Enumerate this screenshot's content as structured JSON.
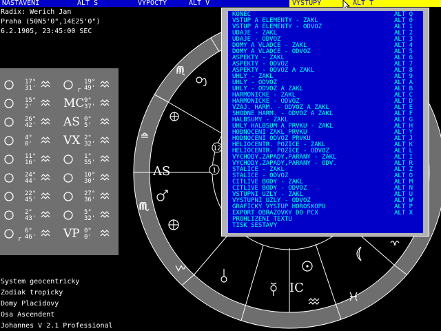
{
  "menubar": {
    "items": [
      "NASTAVENI",
      "ALT S",
      "VYPOCTY",
      "ALT V",
      "VYSTUPY",
      "ALT T"
    ]
  },
  "chart_info": {
    "radix": "Radix: Werich Jan",
    "place": "Praha (50N5'0\",14E25'0\")",
    "datetime": "6.2.1905, 23:45:00 SEC"
  },
  "planets": {
    "left": [
      {
        "symbol": "sun-icon",
        "deg": "17°",
        "min": "31'",
        "sign": "aquarius-icon"
      },
      {
        "symbol": "moon-icon",
        "deg": "15°",
        "min": "2'",
        "sign": "pisces-icon"
      },
      {
        "symbol": "mercury-icon",
        "deg": "26°",
        "min": "42'",
        "sign": "capricorn-icon"
      },
      {
        "symbol": "venus-icon",
        "deg": "4°",
        "min": "0'",
        "sign": "aries-icon"
      },
      {
        "symbol": "mars-icon",
        "deg": "11°",
        "min": "16'",
        "sign": "virgo-icon"
      },
      {
        "symbol": "jupiter-icon",
        "deg": "24°",
        "min": "44'",
        "sign": "aries-icon"
      },
      {
        "symbol": "saturn-icon",
        "deg": "22°",
        "min": "45'",
        "sign": "aquarius-icon"
      },
      {
        "symbol": "uranus-icon",
        "deg": "2°",
        "min": "43'",
        "sign": "capricorn-icon"
      },
      {
        "symbol": "neptune-icon",
        "deg": "6°",
        "min": "46'",
        "sign": "cancer-icon",
        "retro": "r"
      }
    ],
    "right": [
      {
        "symbol": "pluto-icon",
        "deg": "19°",
        "min": "49'",
        "sign": "gemini-icon",
        "retro": "r"
      },
      {
        "symbol": "mc-icon",
        "label": "MC",
        "deg": "9°",
        "min": "37'",
        "sign": "leo-icon"
      },
      {
        "symbol": "asc-icon",
        "label": "AS",
        "deg": "0°",
        "min": "5'",
        "sign": "virgo-icon"
      },
      {
        "symbol": "vertex-icon",
        "label": "VX",
        "deg": "2°",
        "min": "32'",
        "sign": "aries-icon"
      },
      {
        "symbol": "lilith-icon",
        "deg": "1°",
        "min": "55'",
        "sign": "aries-icon"
      },
      {
        "symbol": "node-icon",
        "deg": "10°",
        "min": "30'",
        "sign": "virgo-icon"
      },
      {
        "symbol": "fortune-icon",
        "deg": "27°",
        "min": "36'",
        "sign": "virgo-icon"
      },
      {
        "symbol": "fortune-alt-icon",
        "deg": "5°",
        "min": "32'",
        "sign": "libra-icon"
      },
      {
        "symbol": "vp-icon",
        "label": "VP",
        "deg": "0°",
        "min": "0'",
        "sign": "aries-icon"
      }
    ]
  },
  "wheel": {
    "labels": {
      "as": "AS",
      "ic": "IC",
      "house_1": "1",
      "house_12": "12"
    }
  },
  "dropdown": {
    "items": [
      {
        "label": "KONEC",
        "key": "ALT Q"
      },
      {
        "label": "VSTUP A ELEMENTY - ZAKL",
        "key": "ALT 0"
      },
      {
        "label": "VSTUP A ELEMENTY - ODVOZ",
        "key": "ALT 1"
      },
      {
        "label": "UDAJE - ZAKL",
        "key": "ALT 2"
      },
      {
        "label": "UDAJE - ODVOZ",
        "key": "ALT 3"
      },
      {
        "label": "DOMY A VLADCE - ZAKL",
        "key": "ALT 4"
      },
      {
        "label": "DOMY A VLADCE - ODVOZ",
        "key": "ALT 5"
      },
      {
        "label": "ASPEKTY - ZAKL",
        "key": "ALT 6"
      },
      {
        "label": "ASPEKTY - ODVOZ",
        "key": "ALT 7"
      },
      {
        "label": "ASPEKTY - ODVOZ A ZAKL",
        "key": "ALT 8"
      },
      {
        "label": "UHLY - ZAKL",
        "key": "ALT 9"
      },
      {
        "label": "UHLY - ODVOZ",
        "key": "ALT A"
      },
      {
        "label": "UHLY - ODVOZ A ZAKL",
        "key": "ALT B"
      },
      {
        "label": "HARMONICKE - ZAKL",
        "key": "ALT C"
      },
      {
        "label": "HARMONICKE - ODVOZ",
        "key": "ALT D"
      },
      {
        "label": "VZAJ. HARM. - ODVOZ A ZAKL",
        "key": "ALT E"
      },
      {
        "label": "SHODNE HARM. - ODVOZ A ZAKL",
        "key": "ALT F"
      },
      {
        "label": "HALBSUMY - ZAKL",
        "key": "ALT G"
      },
      {
        "label": "UHLY HALBSUM A PRVKU - ZAKL",
        "key": "ALT H"
      },
      {
        "label": "HODNOCENI ZAKL PRVKU",
        "key": "ALT Y"
      },
      {
        "label": "HODNOCENI ODVOZ PRVKU",
        "key": "ALT J"
      },
      {
        "label": "HELIOCENTR. POZICE - ZAKL",
        "key": "ALT K"
      },
      {
        "label": "HELIOCENTR. POZICE - ODVOZ",
        "key": "ALT L"
      },
      {
        "label": "VYCHODY,ZAPADY,PARANY - ZAKL",
        "key": "ALT I"
      },
      {
        "label": "VYCHODY,ZAPADY,PARANY - ODV.",
        "key": "ALT R"
      },
      {
        "label": "STALICE - ZAKL",
        "key": "ALT Z"
      },
      {
        "label": "STALICE - ODVOZ",
        "key": "ALT O"
      },
      {
        "label": "CITLIVE BODY - ZAKL",
        "key": "ALT M"
      },
      {
        "label": "CITLIVE BODY - ODVOZ",
        "key": "ALT N"
      },
      {
        "label": "VSTUPNI UZLY - ZAKL",
        "key": "ALT U"
      },
      {
        "label": "VYSTUPNI UZLY - ODVOZ",
        "key": "ALT W"
      },
      {
        "label": "GRAFICKY VYSTUP HOROSKOPU",
        "key": "ALT P"
      },
      {
        "label": "EXPORT OBRAZOVKY DO PCX",
        "key": "ALT X"
      },
      {
        "label": "PROHLIZENI TEXTU",
        "key": ""
      },
      {
        "label": "TISK SESTAVY",
        "key": ""
      }
    ]
  },
  "status": {
    "system": "System geocentricky",
    "zodiac": "Zodiak tropicky",
    "houses": "Domy Placidovy",
    "axis": "Osa Ascendent",
    "version": "Johannes V 2.1 Professional"
  },
  "colors": {
    "menubar_bg": "#0000c8",
    "menubar_active": "#ffff00",
    "dropdown_bg": "#0000c8",
    "dropdown_text": "#00ffff",
    "dropdown_frame": "#b4b4b4",
    "panel_bg": "#707070",
    "wheel_ring": "#6e6e6e"
  }
}
